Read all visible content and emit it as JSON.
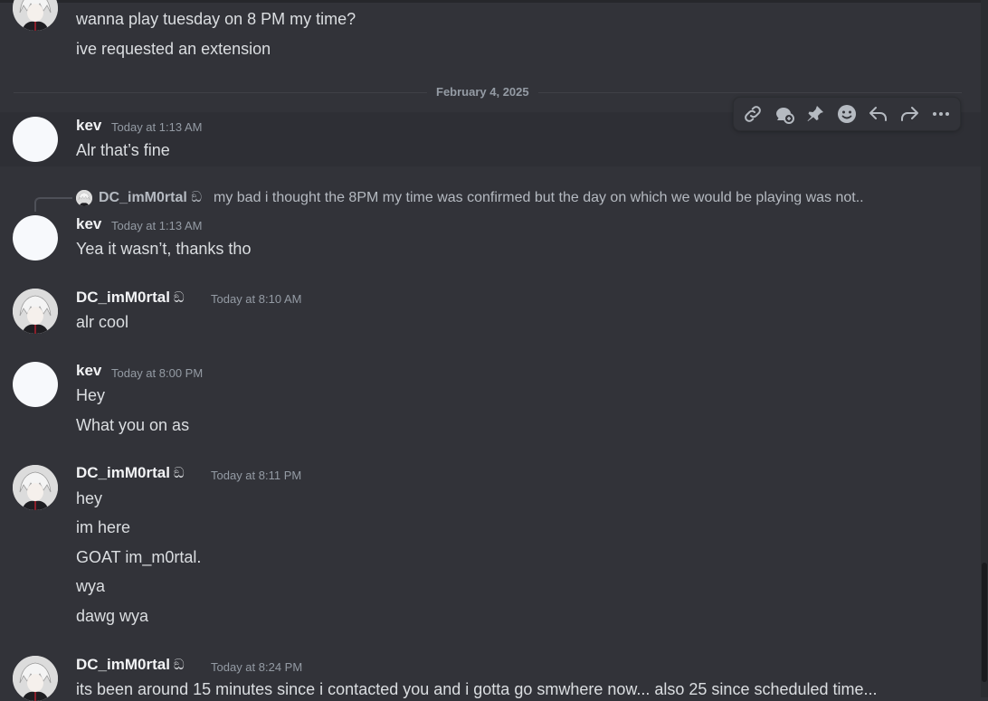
{
  "date_divider": "February 4, 2025",
  "tag_glyph": "ඞ",
  "users": {
    "kev": "kev",
    "dc": "DC_imM0rtal"
  },
  "messages": {
    "m0": {
      "lines": [
        "wanna play tuesday on 8 PM my time?",
        "ive requested an extension"
      ]
    },
    "m1": {
      "author": "kev",
      "time": "Today at 1:13 AM",
      "lines": [
        "Alr that’s fine"
      ]
    },
    "m2": {
      "reply": {
        "author": "DC_imM0rtal",
        "text": "my bad i thought the 8PM my time was confirmed but the day on which we would be playing was not.."
      },
      "author": "kev",
      "time": "Today at 1:13 AM",
      "lines": [
        "Yea it wasn’t, thanks tho"
      ]
    },
    "m3": {
      "author": "DC_imM0rtal",
      "time": "Today at 8:10 AM",
      "lines": [
        "alr cool"
      ]
    },
    "m4": {
      "author": "kev",
      "time": "Today at 8:00 PM",
      "lines": [
        "Hey",
        "What you on as"
      ]
    },
    "m5": {
      "author": "DC_imM0rtal",
      "time": "Today at 8:11 PM",
      "lines": [
        "hey",
        "im here",
        "GOAT im_m0rtal.",
        "wya",
        "dawg wya"
      ]
    },
    "m6": {
      "author": "DC_imM0rtal",
      "time": "Today at 8:24 PM",
      "lines": [
        "its been around 15 minutes since i contacted you and i gotta go smwhere now... also 25 since scheduled time..."
      ]
    }
  },
  "toolbar": {
    "icons": [
      "link-icon",
      "thread-icon",
      "pin-icon",
      "emoji-icon",
      "reply-icon",
      "forward-icon",
      "more-icon"
    ]
  },
  "colors": {
    "background": "#323339",
    "hover_row": "#2e2f35",
    "text": "#dbdee1",
    "muted": "#949ba4",
    "username": "#f2f3f5"
  }
}
